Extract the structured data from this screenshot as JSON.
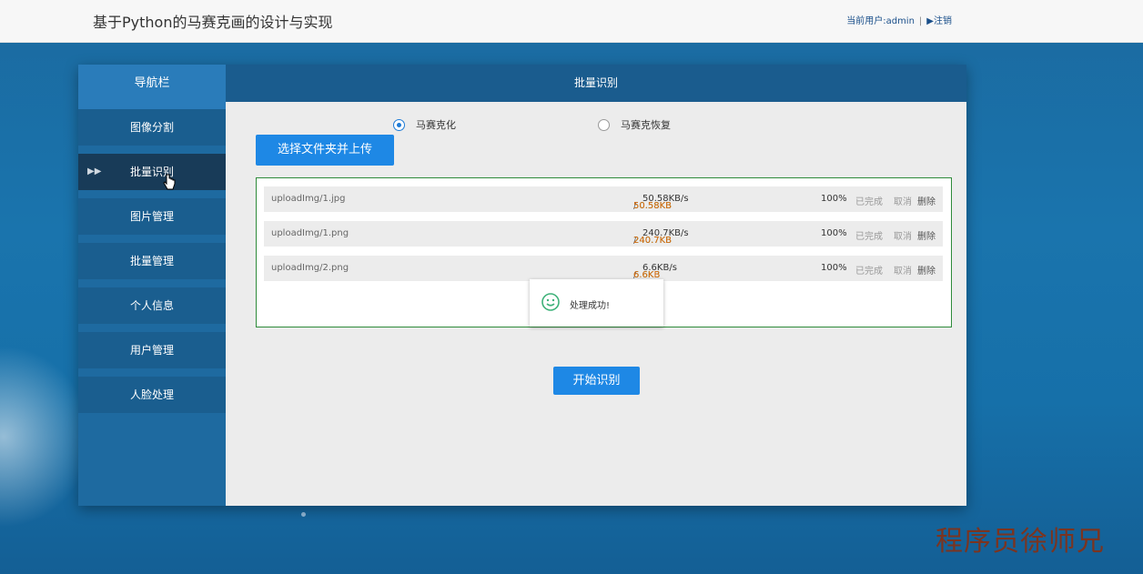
{
  "header": {
    "title": "基于Python的马赛克画的设计与实现",
    "user_label": "当前用户:admin",
    "separator": "|",
    "logout_label": "▶注销"
  },
  "sidebar": {
    "title": "导航栏",
    "items": [
      {
        "label": "图像分割"
      },
      {
        "label": "批量识别",
        "active": true
      },
      {
        "label": "图片管理"
      },
      {
        "label": "批量管理"
      },
      {
        "label": "个人信息"
      },
      {
        "label": "用户管理"
      },
      {
        "label": "人脸处理"
      }
    ]
  },
  "main": {
    "title": "批量识别",
    "radio_options": [
      {
        "label": "马赛克化",
        "checked": true
      },
      {
        "label": "马赛克恢复",
        "checked": false
      }
    ],
    "upload_button": "选择文件夹并上传",
    "files": [
      {
        "name": "uploadImg/1.jpg",
        "loaded": "50.58KB",
        "sep": " / ",
        "total": "50.58KB",
        "speed": "50.58KB/s",
        "percent": "100%",
        "status": "已完成",
        "cancel": "取消",
        "delete": "删除"
      },
      {
        "name": "uploadImg/1.png",
        "loaded": "240.7KB",
        "sep": " / ",
        "total": "240.7KB",
        "speed": "240.7KB/s",
        "percent": "100%",
        "status": "已完成",
        "cancel": "取消",
        "delete": "删除"
      },
      {
        "name": "uploadImg/2.png",
        "loaded": "6.6KB",
        "sep": " / ",
        "total": "6.6KB",
        "speed": "6.6KB/s",
        "percent": "100%",
        "status": "已完成",
        "cancel": "取消",
        "delete": "删除"
      }
    ],
    "toast": {
      "text": "处理成功!",
      "icon": "smile-icon"
    },
    "start_button": "开始识别"
  },
  "watermark": "程序员徐师兄",
  "colors": {
    "accent": "#1e88e5",
    "success_border": "#2e8b3a",
    "loaded": "#2e8b2e",
    "total": "#e06a10"
  }
}
